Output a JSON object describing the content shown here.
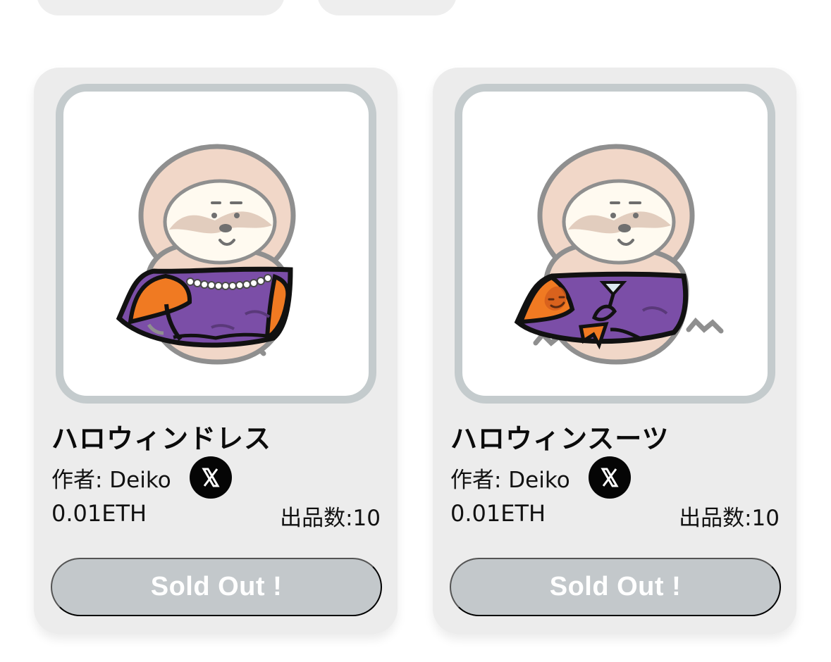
{
  "cards": [
    {
      "title": "ハロウィンドレス",
      "author_label": "作者: Deiko",
      "author_social_icon": "x-logo-icon",
      "price": "0.01ETH",
      "count_label": "出品数:10",
      "button_label": "Sold Out !",
      "artwork_outfit": "halloween-dress"
    },
    {
      "title": "ハロウィンスーツ",
      "author_label": "作者: Deiko",
      "author_social_icon": "x-logo-icon",
      "price": "0.01ETH",
      "count_label": "出品数:10",
      "button_label": "Sold Out !",
      "artwork_outfit": "halloween-suit"
    }
  ],
  "colors": {
    "card_background": "#ececec",
    "art_border": "#c4cbcd",
    "sold_out_button": "#c3c8cb",
    "sold_out_text": "#ffffff",
    "dress_orange": "#f07a22",
    "dress_purple": "#7b4ea7",
    "sloth_fur": "#f1d7c8"
  }
}
